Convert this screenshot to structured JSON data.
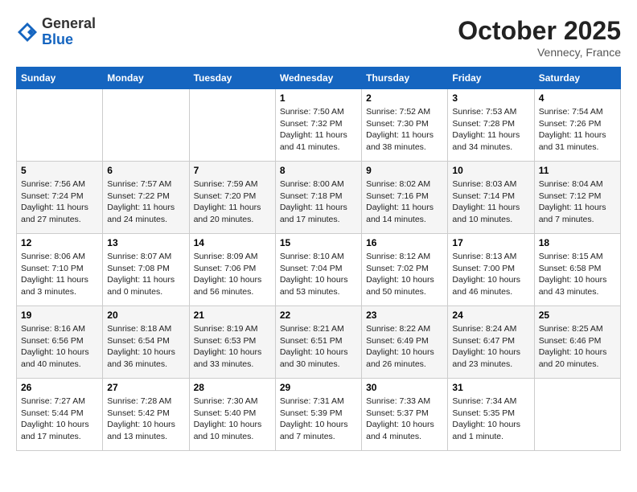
{
  "header": {
    "logo_general": "General",
    "logo_blue": "Blue",
    "month_title": "October 2025",
    "subtitle": "Vennecy, France"
  },
  "weekdays": [
    "Sunday",
    "Monday",
    "Tuesday",
    "Wednesday",
    "Thursday",
    "Friday",
    "Saturday"
  ],
  "weeks": [
    [
      {
        "day": "",
        "info": ""
      },
      {
        "day": "",
        "info": ""
      },
      {
        "day": "",
        "info": ""
      },
      {
        "day": "1",
        "info": "Sunrise: 7:50 AM\nSunset: 7:32 PM\nDaylight: 11 hours and 41 minutes."
      },
      {
        "day": "2",
        "info": "Sunrise: 7:52 AM\nSunset: 7:30 PM\nDaylight: 11 hours and 38 minutes."
      },
      {
        "day": "3",
        "info": "Sunrise: 7:53 AM\nSunset: 7:28 PM\nDaylight: 11 hours and 34 minutes."
      },
      {
        "day": "4",
        "info": "Sunrise: 7:54 AM\nSunset: 7:26 PM\nDaylight: 11 hours and 31 minutes."
      }
    ],
    [
      {
        "day": "5",
        "info": "Sunrise: 7:56 AM\nSunset: 7:24 PM\nDaylight: 11 hours and 27 minutes."
      },
      {
        "day": "6",
        "info": "Sunrise: 7:57 AM\nSunset: 7:22 PM\nDaylight: 11 hours and 24 minutes."
      },
      {
        "day": "7",
        "info": "Sunrise: 7:59 AM\nSunset: 7:20 PM\nDaylight: 11 hours and 20 minutes."
      },
      {
        "day": "8",
        "info": "Sunrise: 8:00 AM\nSunset: 7:18 PM\nDaylight: 11 hours and 17 minutes."
      },
      {
        "day": "9",
        "info": "Sunrise: 8:02 AM\nSunset: 7:16 PM\nDaylight: 11 hours and 14 minutes."
      },
      {
        "day": "10",
        "info": "Sunrise: 8:03 AM\nSunset: 7:14 PM\nDaylight: 11 hours and 10 minutes."
      },
      {
        "day": "11",
        "info": "Sunrise: 8:04 AM\nSunset: 7:12 PM\nDaylight: 11 hours and 7 minutes."
      }
    ],
    [
      {
        "day": "12",
        "info": "Sunrise: 8:06 AM\nSunset: 7:10 PM\nDaylight: 11 hours and 3 minutes."
      },
      {
        "day": "13",
        "info": "Sunrise: 8:07 AM\nSunset: 7:08 PM\nDaylight: 11 hours and 0 minutes."
      },
      {
        "day": "14",
        "info": "Sunrise: 8:09 AM\nSunset: 7:06 PM\nDaylight: 10 hours and 56 minutes."
      },
      {
        "day": "15",
        "info": "Sunrise: 8:10 AM\nSunset: 7:04 PM\nDaylight: 10 hours and 53 minutes."
      },
      {
        "day": "16",
        "info": "Sunrise: 8:12 AM\nSunset: 7:02 PM\nDaylight: 10 hours and 50 minutes."
      },
      {
        "day": "17",
        "info": "Sunrise: 8:13 AM\nSunset: 7:00 PM\nDaylight: 10 hours and 46 minutes."
      },
      {
        "day": "18",
        "info": "Sunrise: 8:15 AM\nSunset: 6:58 PM\nDaylight: 10 hours and 43 minutes."
      }
    ],
    [
      {
        "day": "19",
        "info": "Sunrise: 8:16 AM\nSunset: 6:56 PM\nDaylight: 10 hours and 40 minutes."
      },
      {
        "day": "20",
        "info": "Sunrise: 8:18 AM\nSunset: 6:54 PM\nDaylight: 10 hours and 36 minutes."
      },
      {
        "day": "21",
        "info": "Sunrise: 8:19 AM\nSunset: 6:53 PM\nDaylight: 10 hours and 33 minutes."
      },
      {
        "day": "22",
        "info": "Sunrise: 8:21 AM\nSunset: 6:51 PM\nDaylight: 10 hours and 30 minutes."
      },
      {
        "day": "23",
        "info": "Sunrise: 8:22 AM\nSunset: 6:49 PM\nDaylight: 10 hours and 26 minutes."
      },
      {
        "day": "24",
        "info": "Sunrise: 8:24 AM\nSunset: 6:47 PM\nDaylight: 10 hours and 23 minutes."
      },
      {
        "day": "25",
        "info": "Sunrise: 8:25 AM\nSunset: 6:46 PM\nDaylight: 10 hours and 20 minutes."
      }
    ],
    [
      {
        "day": "26",
        "info": "Sunrise: 7:27 AM\nSunset: 5:44 PM\nDaylight: 10 hours and 17 minutes."
      },
      {
        "day": "27",
        "info": "Sunrise: 7:28 AM\nSunset: 5:42 PM\nDaylight: 10 hours and 13 minutes."
      },
      {
        "day": "28",
        "info": "Sunrise: 7:30 AM\nSunset: 5:40 PM\nDaylight: 10 hours and 10 minutes."
      },
      {
        "day": "29",
        "info": "Sunrise: 7:31 AM\nSunset: 5:39 PM\nDaylight: 10 hours and 7 minutes."
      },
      {
        "day": "30",
        "info": "Sunrise: 7:33 AM\nSunset: 5:37 PM\nDaylight: 10 hours and 4 minutes."
      },
      {
        "day": "31",
        "info": "Sunrise: 7:34 AM\nSunset: 5:35 PM\nDaylight: 10 hours and 1 minute."
      },
      {
        "day": "",
        "info": ""
      }
    ]
  ]
}
